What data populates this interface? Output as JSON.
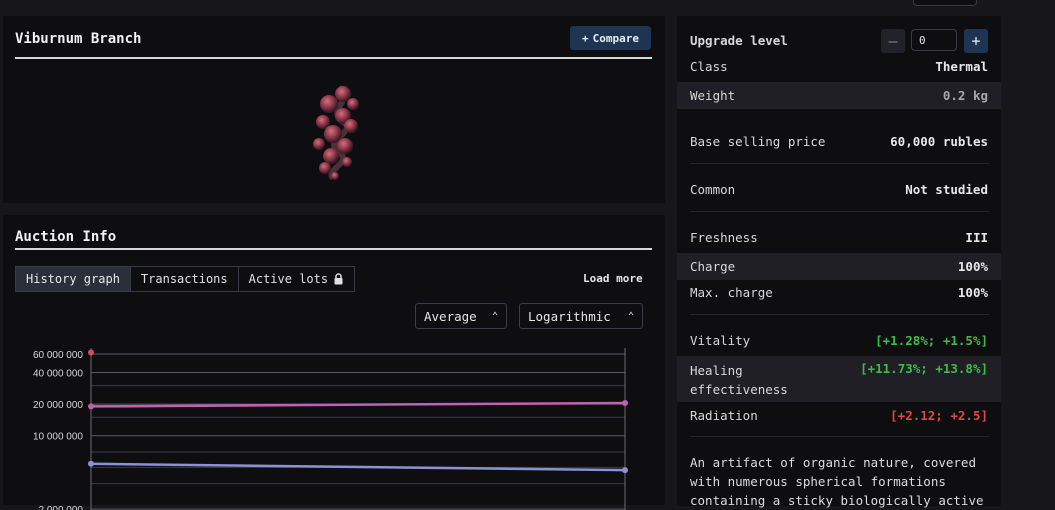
{
  "item": {
    "title": "Viburnum Branch",
    "compare_label": "Compare",
    "compare_icon": "plus-icon"
  },
  "auction": {
    "title": "Auction Info",
    "tabs": [
      {
        "label": "History graph",
        "active": true
      },
      {
        "label": "Transactions",
        "active": false
      },
      {
        "label": "Active lots",
        "active": false,
        "icon": "lock-icon"
      }
    ],
    "load_more": "Load more",
    "mode_select": "Average",
    "scale_select": "Logarithmic"
  },
  "chart_data": {
    "type": "line",
    "yscale": "log",
    "y_ticks": [
      "60 000 000",
      "40 000 000",
      "20 000 000",
      "10 000 000",
      "2 000 000"
    ],
    "y_tick_values": [
      60000000,
      40000000,
      20000000,
      10000000,
      2000000
    ],
    "series": [
      {
        "color": "#c062b4",
        "x": [
          0,
          1
        ],
        "values": [
          19000000,
          20500000
        ]
      },
      {
        "color": "#8c90d8",
        "x": [
          0,
          1
        ],
        "values": [
          5400000,
          4700000
        ]
      },
      {
        "color": "#e04860",
        "x": [
          0
        ],
        "values": [
          62000000
        ]
      }
    ],
    "grid": true
  },
  "stats": {
    "upgrade_label": "Upgrade level",
    "upgrade_value": "0",
    "rows": [
      {
        "label": "Class",
        "value": "Thermal",
        "color": ""
      },
      {
        "label": "Weight",
        "value": "0.2 kg",
        "color": "muted"
      },
      {
        "label": "Base selling price",
        "value": "60,000 rubles",
        "color": ""
      },
      {
        "label": "Common",
        "value": "Not studied",
        "color": ""
      },
      {
        "label": "Freshness",
        "value": "III",
        "color": ""
      },
      {
        "label": "Charge",
        "value": "100%",
        "color": ""
      },
      {
        "label": "Max. charge",
        "value": "100%",
        "color": ""
      },
      {
        "label": "Vitality",
        "value": "[+1.28%; +1.5%]",
        "color": "green"
      },
      {
        "label": "Healing effectiveness",
        "value": "[+11.73%; +13.8%]",
        "color": "green"
      },
      {
        "label": "Radiation",
        "value": "[+2.12; +2.5]",
        "color": "red"
      }
    ],
    "description": "An artifact of organic nature, covered with numerous spherical formations containing a sticky biologically active"
  },
  "colors": {
    "accent": "#1d3552",
    "positive": "#3cbd4a",
    "negative": "#e04848"
  }
}
